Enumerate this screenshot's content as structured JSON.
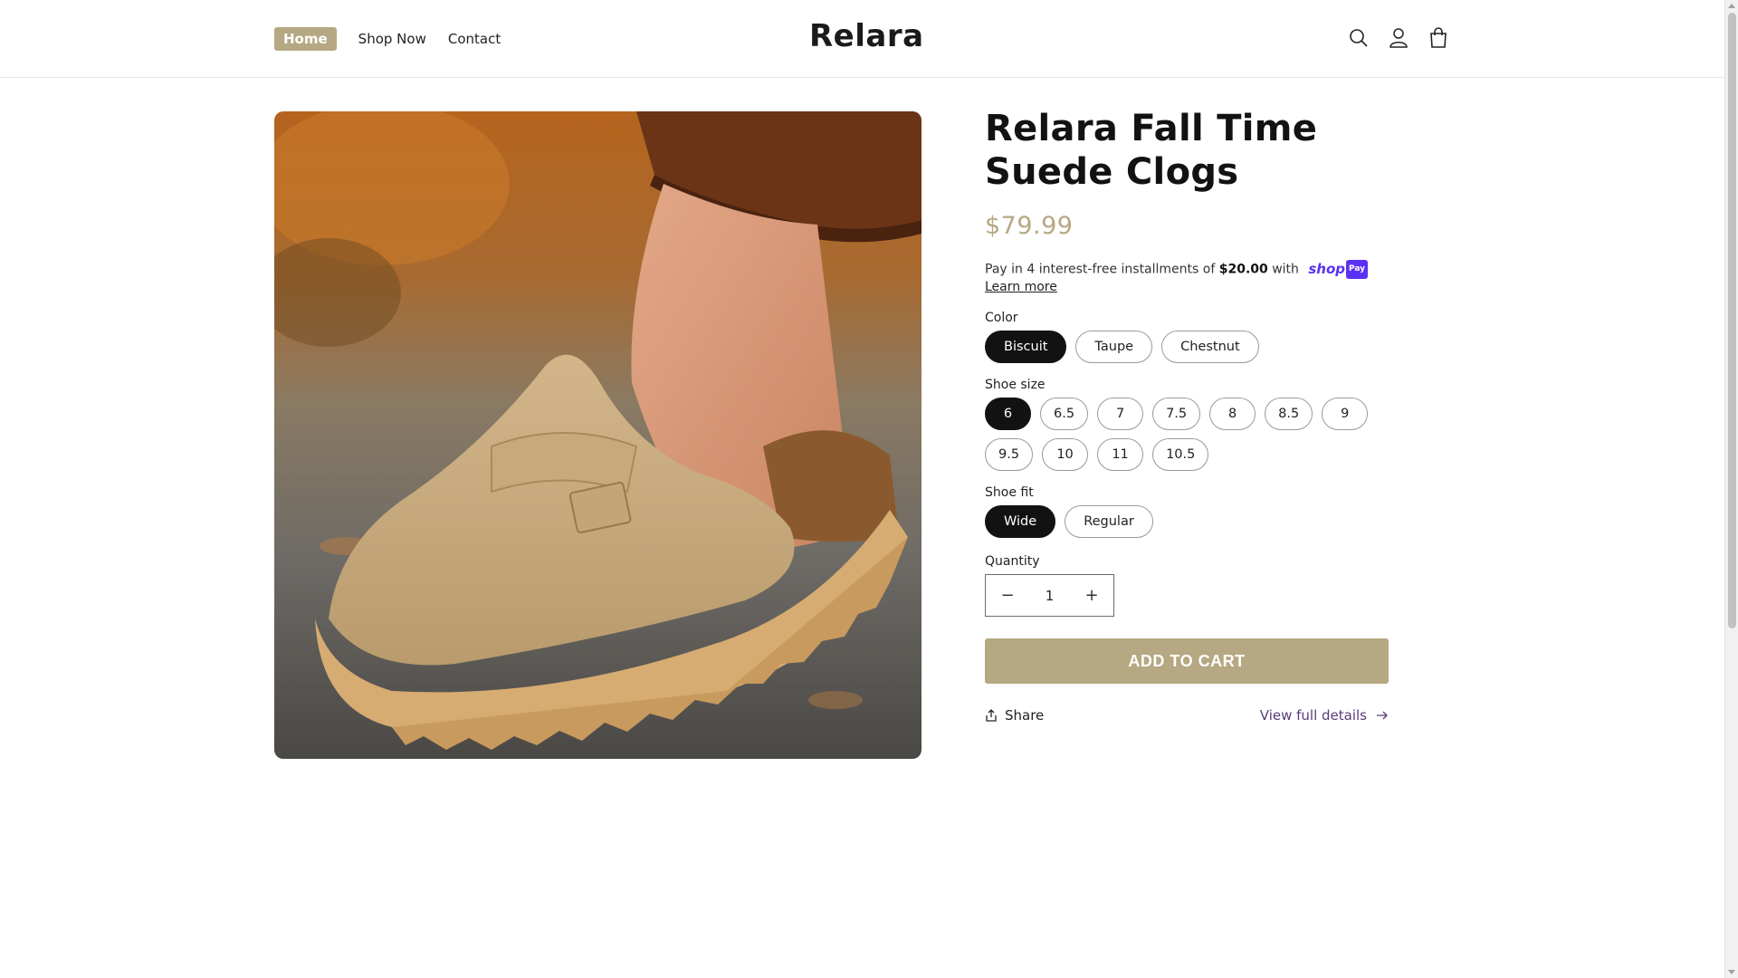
{
  "header": {
    "nav": [
      "Home",
      "Shop Now",
      "Contact"
    ],
    "logo": "Relara",
    "icons": [
      "search-icon",
      "account-icon",
      "cart-icon"
    ]
  },
  "product": {
    "title": "Relara Fall Time Suede Clogs",
    "price": "$79.99",
    "installments": {
      "prefix": "Pay in 4 interest-free installments of ",
      "amount": "$20.00",
      "suffix": " with",
      "brand": "shop",
      "brand_badge": "Pay",
      "learn_more": "Learn more"
    },
    "color": {
      "label": "Color",
      "options": [
        "Biscuit",
        "Taupe",
        "Chestnut"
      ],
      "selected": "Biscuit"
    },
    "size": {
      "label": "Shoe size",
      "options": [
        "6",
        "6.5",
        "7",
        "7.5",
        "8",
        "8.5",
        "9",
        "9.5",
        "10",
        "11",
        "10.5"
      ],
      "selected": "6"
    },
    "fit": {
      "label": "Shoe fit",
      "options": [
        "Wide",
        "Regular"
      ],
      "selected": "Wide"
    },
    "quantity": {
      "label": "Quantity",
      "value": "1",
      "minus": "−",
      "plus": "+"
    },
    "add_to_cart": "ADD TO CART",
    "share": "Share",
    "view_details": "View full details"
  },
  "colors": {
    "accent": "#b5a882",
    "selected_pill": "#121212",
    "link": "#5a3d7a",
    "shoppay": "#5a31f4"
  }
}
